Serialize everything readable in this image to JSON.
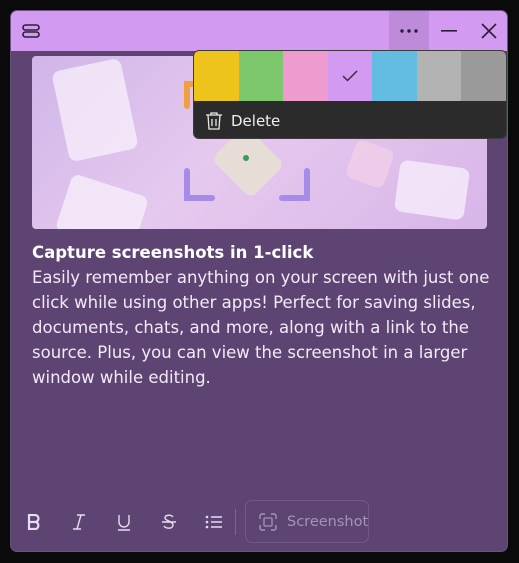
{
  "titlebar": {
    "menu_icon": "hamburger-icon",
    "more_icon": "more-icon",
    "minimize_icon": "minimize-icon",
    "close_icon": "close-icon"
  },
  "note": {
    "title": "Capture screenshots in 1-click",
    "body": "Easily remember anything on your screen with just one click while using other apps! Perfect for saving slides, documents, chats, and more, along with a link to the source. Plus, you can view the screenshot in a larger window while editing."
  },
  "toolbar": {
    "bold_icon": "bold-icon",
    "italic_icon": "italic-icon",
    "underline_icon": "underline-icon",
    "strikethrough_icon": "strikethrough-icon",
    "list_icon": "bullet-list-icon",
    "screenshot_label": "Screenshot"
  },
  "color_menu": {
    "colors": [
      {
        "name": "yellow",
        "hex": "#eec41c",
        "selected": false
      },
      {
        "name": "green",
        "hex": "#7dc86d",
        "selected": false
      },
      {
        "name": "pink",
        "hex": "#ee9bd0",
        "selected": false
      },
      {
        "name": "purple",
        "hex": "#d29bf1",
        "selected": true
      },
      {
        "name": "blue",
        "hex": "#63bde2",
        "selected": false
      },
      {
        "name": "gray",
        "hex": "#b3b3b3",
        "selected": false
      },
      {
        "name": "charcoal",
        "hex": "#9a9a9a",
        "selected": false
      }
    ],
    "delete_label": "Delete"
  }
}
